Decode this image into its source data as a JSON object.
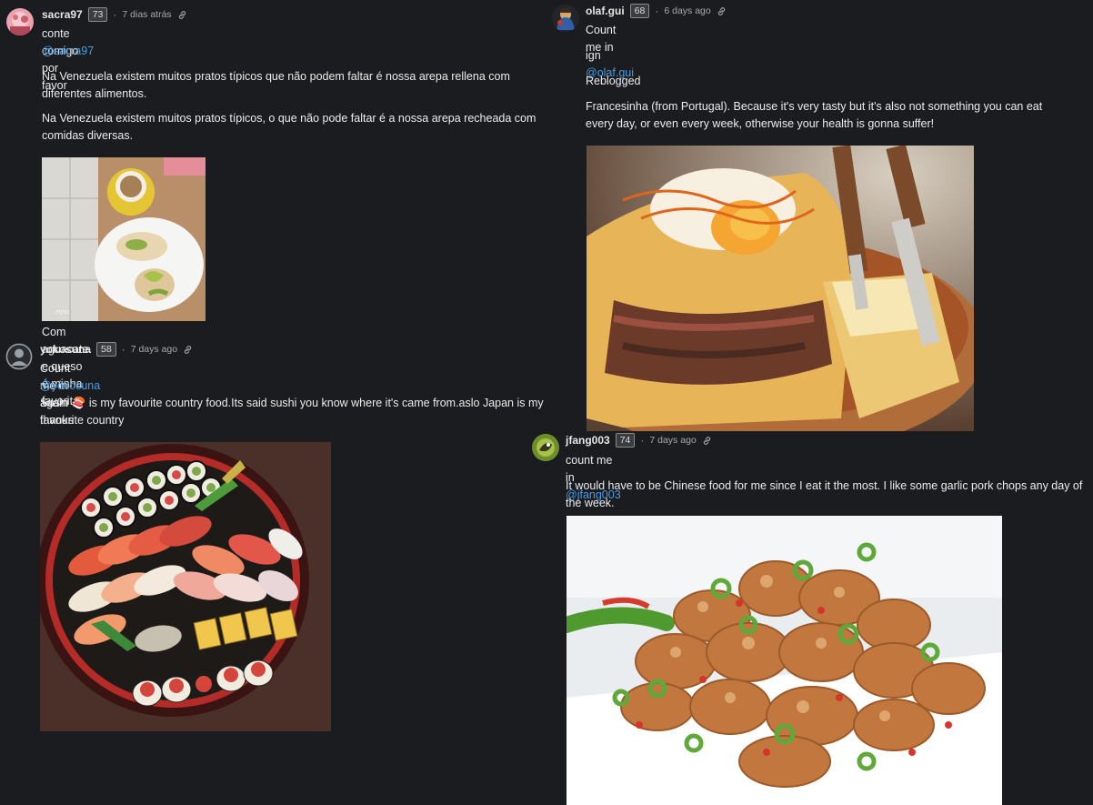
{
  "comments": [
    {
      "user": "sacra97",
      "rep": "73",
      "time": "7 dias atrás",
      "line1": "conte comigo por favor",
      "mention": "@sacra97",
      "para1": "Na Venezuela existem muitos pratos típicos que não podem faltar é nossa arepa rellena com diferentes alimentos.",
      "para2": "Na Venezuela existem muitos pratos típicos, o que não pode faltar é a nossa arepa recheada com comidas diversas.",
      "caption": "Com aguacate e queso é minha favorita.",
      "image_alt": "arepa-with-avocado-photo"
    },
    {
      "user": "yokosuna",
      "rep": "58",
      "time": "7 days ago",
      "line1": "Count me in again thanks",
      "mention": "@yokosuna",
      "para1_a": "Sushi",
      "para1_emoji": "🍣",
      "para1_b": "is my favourite country food.Its said sushi you know where it's came from.aslo Japan is my favourite country",
      "image_alt": "sushi-platter-photo"
    },
    {
      "user": "olaf.gui",
      "rep": "68",
      "time": "6 days ago",
      "line1": "Count me in",
      "ign_label": "ign",
      "mention": "@olaf.gui",
      "line3": "Reblogged",
      "para1": "Francesinha (from Portugal). Because it's very tasty but it's also not something you can eat every day, or even every week, otherwise your health is gonna suffer!",
      "image_alt": "francesinha-photo"
    },
    {
      "user": "jfang003",
      "rep": "74",
      "time": "7 days ago",
      "line1": "count me in",
      "mention": "@jfang003",
      "para1": "It would have to be Chinese food for me since I eat it the most. I like some garlic pork chops any day of the week.",
      "image_alt": "garlic-pork-chops-photo"
    }
  ],
  "colors": {
    "background": "#1a1c20",
    "mention": "#4a9de0",
    "text": "#ececec"
  }
}
